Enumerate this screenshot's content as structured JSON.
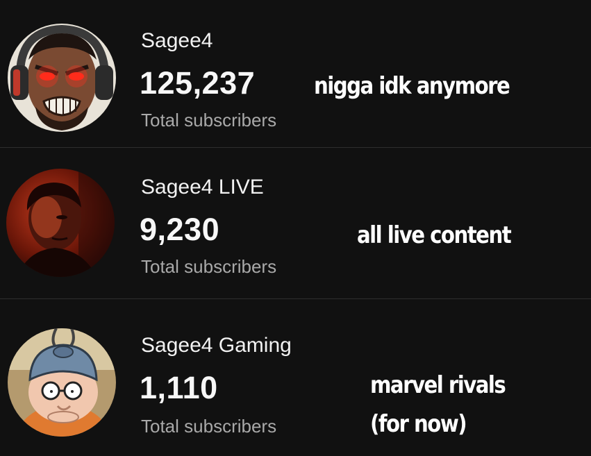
{
  "channels": [
    {
      "name": "Sagee4",
      "subscribers": "125,237",
      "subscribers_label": "Total subscribers",
      "caption": "nigga idk anymore",
      "avatar": "angry-headset-character-avatar"
    },
    {
      "name": "Sagee4 LIVE",
      "subscribers": "9,230",
      "subscribers_label": "Total subscribers",
      "caption": "all live content",
      "avatar": "red-lit-portrait-avatar"
    },
    {
      "name": "Sagee4 Gaming",
      "subscribers": "1,110",
      "subscribers_label": "Total subscribers",
      "caption_line1": "marvel rivals",
      "caption_line2": "(for now)",
      "avatar": "cartoon-dad-helmet-avatar"
    }
  ],
  "colors": {
    "background": "#111111",
    "divider": "#2e2e2e",
    "primary_text": "#f7f7f7",
    "secondary_text": "#a9a9a9"
  }
}
